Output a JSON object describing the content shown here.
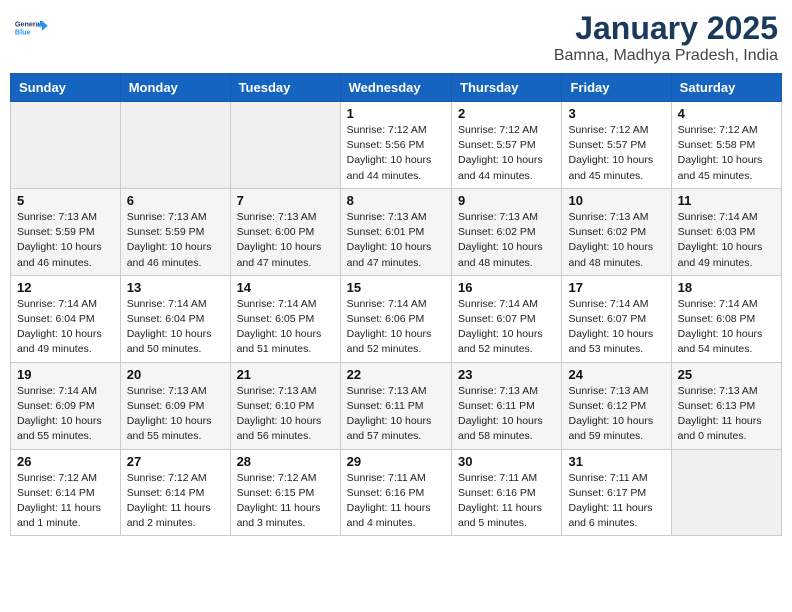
{
  "header": {
    "logo_line1": "General",
    "logo_line2": "Blue",
    "month": "January 2025",
    "location": "Bamna, Madhya Pradesh, India"
  },
  "weekdays": [
    "Sunday",
    "Monday",
    "Tuesday",
    "Wednesday",
    "Thursday",
    "Friday",
    "Saturday"
  ],
  "weeks": [
    [
      {
        "day": "",
        "info": ""
      },
      {
        "day": "",
        "info": ""
      },
      {
        "day": "",
        "info": ""
      },
      {
        "day": "1",
        "info": "Sunrise: 7:12 AM\nSunset: 5:56 PM\nDaylight: 10 hours\nand 44 minutes."
      },
      {
        "day": "2",
        "info": "Sunrise: 7:12 AM\nSunset: 5:57 PM\nDaylight: 10 hours\nand 44 minutes."
      },
      {
        "day": "3",
        "info": "Sunrise: 7:12 AM\nSunset: 5:57 PM\nDaylight: 10 hours\nand 45 minutes."
      },
      {
        "day": "4",
        "info": "Sunrise: 7:12 AM\nSunset: 5:58 PM\nDaylight: 10 hours\nand 45 minutes."
      }
    ],
    [
      {
        "day": "5",
        "info": "Sunrise: 7:13 AM\nSunset: 5:59 PM\nDaylight: 10 hours\nand 46 minutes."
      },
      {
        "day": "6",
        "info": "Sunrise: 7:13 AM\nSunset: 5:59 PM\nDaylight: 10 hours\nand 46 minutes."
      },
      {
        "day": "7",
        "info": "Sunrise: 7:13 AM\nSunset: 6:00 PM\nDaylight: 10 hours\nand 47 minutes."
      },
      {
        "day": "8",
        "info": "Sunrise: 7:13 AM\nSunset: 6:01 PM\nDaylight: 10 hours\nand 47 minutes."
      },
      {
        "day": "9",
        "info": "Sunrise: 7:13 AM\nSunset: 6:02 PM\nDaylight: 10 hours\nand 48 minutes."
      },
      {
        "day": "10",
        "info": "Sunrise: 7:13 AM\nSunset: 6:02 PM\nDaylight: 10 hours\nand 48 minutes."
      },
      {
        "day": "11",
        "info": "Sunrise: 7:14 AM\nSunset: 6:03 PM\nDaylight: 10 hours\nand 49 minutes."
      }
    ],
    [
      {
        "day": "12",
        "info": "Sunrise: 7:14 AM\nSunset: 6:04 PM\nDaylight: 10 hours\nand 49 minutes."
      },
      {
        "day": "13",
        "info": "Sunrise: 7:14 AM\nSunset: 6:04 PM\nDaylight: 10 hours\nand 50 minutes."
      },
      {
        "day": "14",
        "info": "Sunrise: 7:14 AM\nSunset: 6:05 PM\nDaylight: 10 hours\nand 51 minutes."
      },
      {
        "day": "15",
        "info": "Sunrise: 7:14 AM\nSunset: 6:06 PM\nDaylight: 10 hours\nand 52 minutes."
      },
      {
        "day": "16",
        "info": "Sunrise: 7:14 AM\nSunset: 6:07 PM\nDaylight: 10 hours\nand 52 minutes."
      },
      {
        "day": "17",
        "info": "Sunrise: 7:14 AM\nSunset: 6:07 PM\nDaylight: 10 hours\nand 53 minutes."
      },
      {
        "day": "18",
        "info": "Sunrise: 7:14 AM\nSunset: 6:08 PM\nDaylight: 10 hours\nand 54 minutes."
      }
    ],
    [
      {
        "day": "19",
        "info": "Sunrise: 7:14 AM\nSunset: 6:09 PM\nDaylight: 10 hours\nand 55 minutes."
      },
      {
        "day": "20",
        "info": "Sunrise: 7:13 AM\nSunset: 6:09 PM\nDaylight: 10 hours\nand 55 minutes."
      },
      {
        "day": "21",
        "info": "Sunrise: 7:13 AM\nSunset: 6:10 PM\nDaylight: 10 hours\nand 56 minutes."
      },
      {
        "day": "22",
        "info": "Sunrise: 7:13 AM\nSunset: 6:11 PM\nDaylight: 10 hours\nand 57 minutes."
      },
      {
        "day": "23",
        "info": "Sunrise: 7:13 AM\nSunset: 6:11 PM\nDaylight: 10 hours\nand 58 minutes."
      },
      {
        "day": "24",
        "info": "Sunrise: 7:13 AM\nSunset: 6:12 PM\nDaylight: 10 hours\nand 59 minutes."
      },
      {
        "day": "25",
        "info": "Sunrise: 7:13 AM\nSunset: 6:13 PM\nDaylight: 11 hours\nand 0 minutes."
      }
    ],
    [
      {
        "day": "26",
        "info": "Sunrise: 7:12 AM\nSunset: 6:14 PM\nDaylight: 11 hours\nand 1 minute."
      },
      {
        "day": "27",
        "info": "Sunrise: 7:12 AM\nSunset: 6:14 PM\nDaylight: 11 hours\nand 2 minutes."
      },
      {
        "day": "28",
        "info": "Sunrise: 7:12 AM\nSunset: 6:15 PM\nDaylight: 11 hours\nand 3 minutes."
      },
      {
        "day": "29",
        "info": "Sunrise: 7:11 AM\nSunset: 6:16 PM\nDaylight: 11 hours\nand 4 minutes."
      },
      {
        "day": "30",
        "info": "Sunrise: 7:11 AM\nSunset: 6:16 PM\nDaylight: 11 hours\nand 5 minutes."
      },
      {
        "day": "31",
        "info": "Sunrise: 7:11 AM\nSunset: 6:17 PM\nDaylight: 11 hours\nand 6 minutes."
      },
      {
        "day": "",
        "info": ""
      }
    ]
  ]
}
